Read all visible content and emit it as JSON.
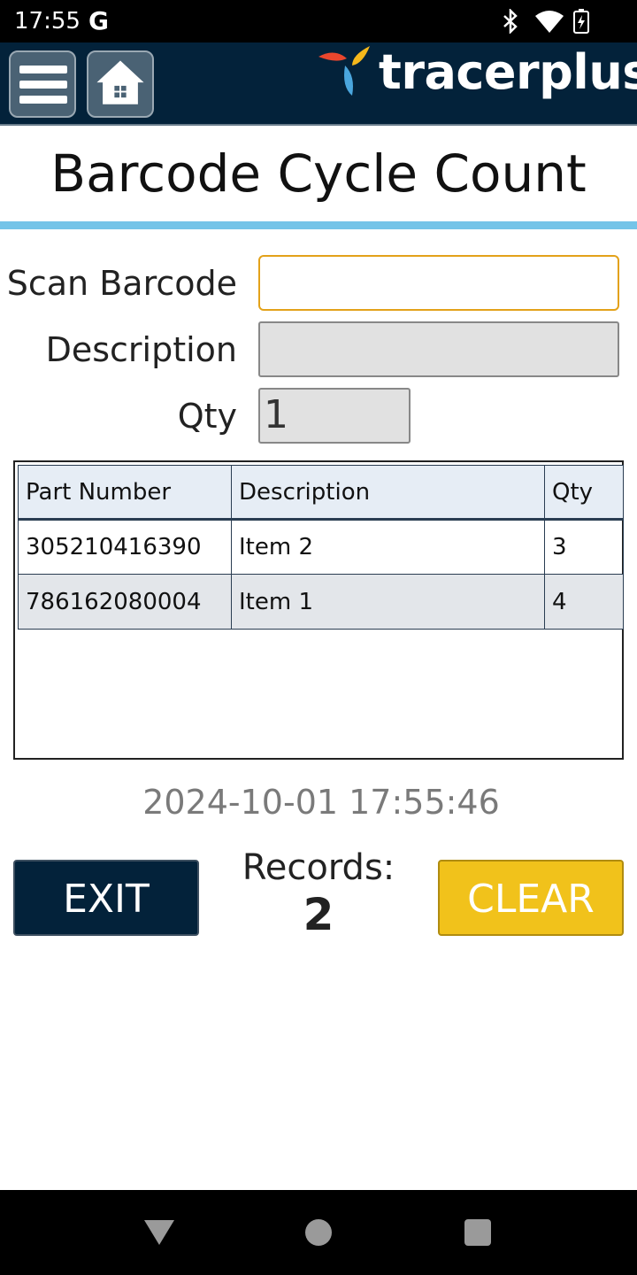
{
  "status_bar": {
    "time": "17:55",
    "carrier_glyph": "G",
    "icons": [
      "bluetooth-icon",
      "wifi-icon",
      "battery-icon"
    ]
  },
  "header": {
    "brand": "tracerplus",
    "menu_icon": "hamburger-icon",
    "home_icon": "home-icon",
    "bar_color": "#03223a"
  },
  "page": {
    "title": "Barcode Cycle Count",
    "accent_color": "#74c4e8"
  },
  "form": {
    "scan_label": "Scan Barcode",
    "scan_value": "",
    "description_label": "Description",
    "description_value": "",
    "qty_label": "Qty",
    "qty_value": "1"
  },
  "grid": {
    "columns": [
      "Part Number",
      "Description",
      "Qty"
    ],
    "rows": [
      [
        "305210416390",
        "Item 2",
        "3"
      ],
      [
        "786162080004",
        "Item 1",
        "4"
      ]
    ]
  },
  "timestamp": "2024-10-01 17:55:46",
  "footer": {
    "exit_label": "EXIT",
    "records_label": "Records:",
    "records_count": "2",
    "clear_label": "CLEAR",
    "clear_color": "#f1c21b"
  },
  "nav_bar": {
    "icons": [
      "back-icon",
      "home-circle-icon",
      "recents-icon"
    ]
  }
}
